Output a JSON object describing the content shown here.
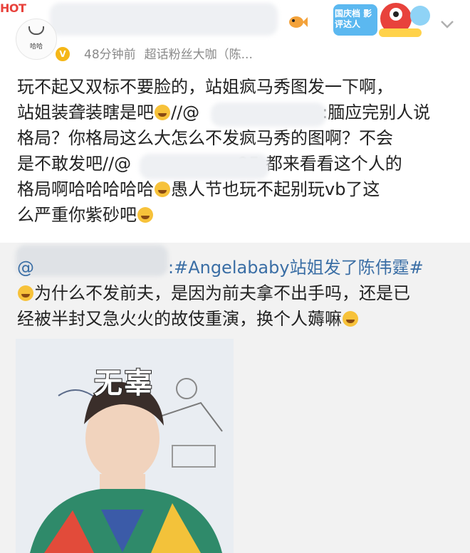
{
  "header": {
    "logo_text": "HOT",
    "avatar_label": "哈哈",
    "verified_mark": "V",
    "time_ago": "48分钟前",
    "badge_text": "超话粉丝大咖（陈...",
    "campaign_badge": "国庆档 影评达人",
    "accent": "#e8423c",
    "icons": [
      "smiley-avatar-icon",
      "verified-badge-icon",
      "fish-icon",
      "chevron-down-icon"
    ]
  },
  "post": {
    "lines": [
      "玩不起又双标不要脸的，站姐疯马秀图发一下啊，",
      "站姐装聋装瞎是吧",
      "//@",
      ":腼应完别人说",
      "格局？你格局这么大怎么不发疯马秀的图啊？不会",
      "是不敢发吧//@",
      "25:都来看看这个人的",
      "格局啊哈哈哈哈哈",
      "愚人节也玩不起别玩vb了这",
      "么严重你紫砂吧"
    ]
  },
  "repost": {
    "at_prefix": "@",
    "topic": ":#Angelababy站姐发了陈伟霆#",
    "line2": "为什么不发前夫，是因为前夫拿不出手吗，还是已",
    "line3": "经被半封又急火火的故伎重演，换个人薅嘛",
    "image_caption": "无辜",
    "tag_color": "#3a6ea5"
  }
}
